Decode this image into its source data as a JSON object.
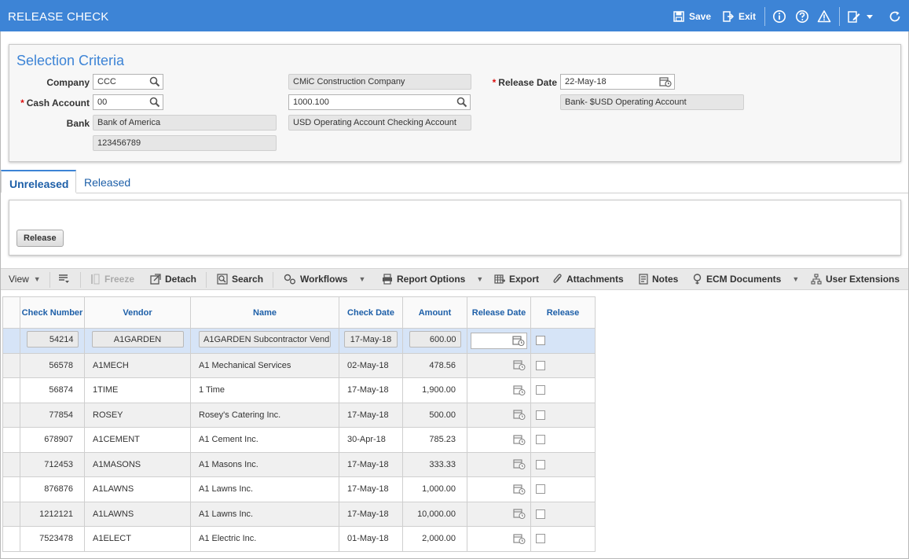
{
  "header": {
    "title": "RELEASE CHECK",
    "save_label": "Save",
    "exit_label": "Exit"
  },
  "criteria": {
    "heading": "Selection Criteria",
    "company_label": "Company",
    "company_value": "CCC",
    "company_name": "CMiC Construction Company",
    "cash_account_label": "Cash Account",
    "cash_account_value": "00",
    "gl_account_value": "1000.100",
    "bank_label": "Bank",
    "bank_name": "Bank of America",
    "bank_account_desc": "USD Operating Account Checking Account",
    "bank_number": "123456789",
    "release_date_label": "Release Date",
    "release_date_value": "22-May-18",
    "bank_desc": "Bank- $USD Operating Account",
    "required_marker": "*"
  },
  "tabs": [
    {
      "label": "Unreleased",
      "active": true
    },
    {
      "label": "Released",
      "active": false
    }
  ],
  "release_button_label": "Release",
  "gridbar": {
    "view": "View",
    "freeze": "Freeze",
    "detach": "Detach",
    "search": "Search",
    "workflows": "Workflows",
    "report_options": "Report Options",
    "export": "Export",
    "attachments": "Attachments",
    "notes": "Notes",
    "ecm_documents": "ECM Documents",
    "user_extensions": "User Extensions"
  },
  "table": {
    "columns": {
      "check_number": "Check Number",
      "vendor": "Vendor",
      "name": "Name",
      "check_date": "Check Date",
      "amount": "Amount",
      "release_date": "Release Date",
      "release": "Release"
    },
    "rows": [
      {
        "check": "54214",
        "vendor": "A1GARDEN",
        "name": "A1GARDEN Subcontractor Vend",
        "date": "17-May-18",
        "amount": "600.00"
      },
      {
        "check": "56578",
        "vendor": "A1MECH",
        "name": "A1 Mechanical Services",
        "date": "02-May-18",
        "amount": "478.56"
      },
      {
        "check": "56874",
        "vendor": "1TIME",
        "name": "1 Time",
        "date": "17-May-18",
        "amount": "1,900.00"
      },
      {
        "check": "77854",
        "vendor": "ROSEY",
        "name": "Rosey's Catering Inc.",
        "date": "17-May-18",
        "amount": "500.00"
      },
      {
        "check": "678907",
        "vendor": "A1CEMENT",
        "name": "A1 Cement Inc.",
        "date": "30-Apr-18",
        "amount": "785.23"
      },
      {
        "check": "712453",
        "vendor": "A1MASONS",
        "name": "A1 Masons Inc.",
        "date": "17-May-18",
        "amount": "333.33"
      },
      {
        "check": "876876",
        "vendor": "A1LAWNS",
        "name": "A1 Lawns Inc.",
        "date": "17-May-18",
        "amount": "1,000.00"
      },
      {
        "check": "1212121",
        "vendor": "A1LAWNS",
        "name": "A1 Lawns Inc.",
        "date": "17-May-18",
        "amount": "10,000.00"
      },
      {
        "check": "7523478",
        "vendor": "A1ELECT",
        "name": "A1 Electric Inc.",
        "date": "01-May-18",
        "amount": "2,000.00"
      }
    ]
  }
}
